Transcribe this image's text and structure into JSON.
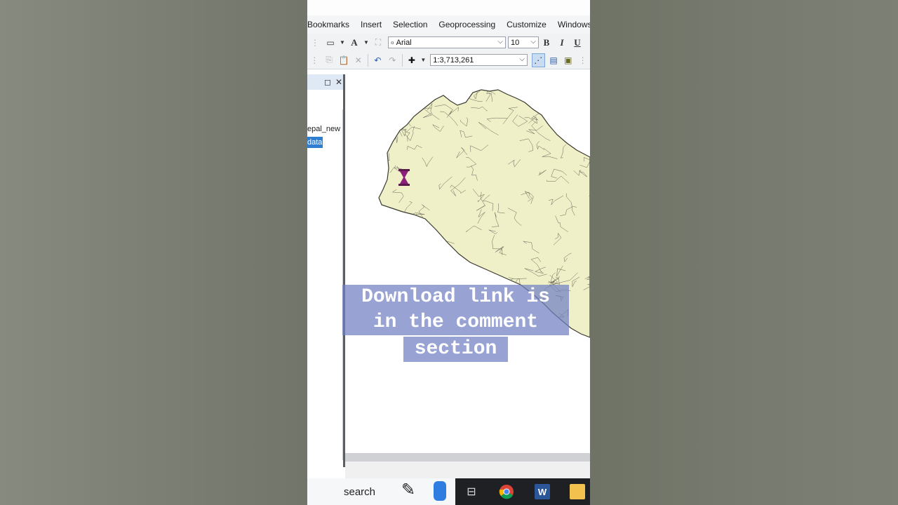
{
  "menu": {
    "items": [
      "Bookmarks",
      "Insert",
      "Selection",
      "Geoprocessing",
      "Customize",
      "Windows"
    ]
  },
  "toolbar": {
    "font_name": "Arial",
    "font_size": "10",
    "scale": "1:3,713,261",
    "bold_label": "B",
    "italic_label": "I",
    "underline_label": "U"
  },
  "toc": {
    "layer_name": "epal_new",
    "layer_sub": "data"
  },
  "taskbar": {
    "search_label": "search"
  },
  "caption": {
    "line1": "Download link is",
    "line2": "in the comment",
    "line3": "section"
  },
  "colors": {
    "map_fill": "#efefc8",
    "map_outline": "#4a4a3c",
    "caption_bg": "#7080c4",
    "selected_layer": "#2f7ecf"
  }
}
